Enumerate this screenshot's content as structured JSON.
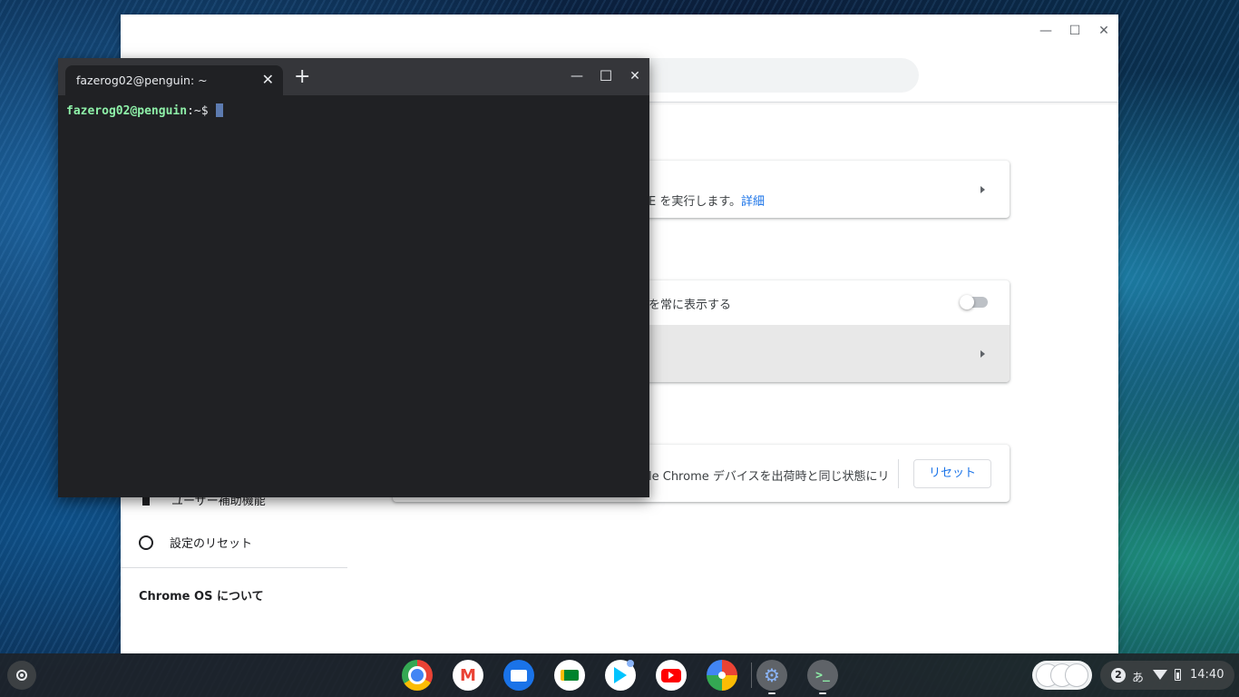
{
  "settings": {
    "card1_text": "E を実行します。",
    "card1_link": "詳細",
    "card2_row1_text": "を常に表示する",
    "card3_text": "le Chrome デバイスを出荷時と同じ状態にリ",
    "reset_button": "リセット",
    "sidebar": {
      "accessibility": "ユーザー補助機能",
      "reset_settings": "設定のリセット",
      "about": "Chrome OS について"
    }
  },
  "terminal": {
    "tab_title": "fazerog02@penguin: ~",
    "prompt_user": "fazerog02@penguin",
    "prompt_rest": ":~$ "
  },
  "shelf": {
    "notification_count": "2",
    "ime": "あ",
    "time": "14:40",
    "apps": [
      "chrome-icon",
      "gmail-icon",
      "files-icon",
      "meet-icon",
      "play-store-icon",
      "youtube-icon",
      "photos-icon",
      "settings-icon",
      "terminal-icon"
    ]
  }
}
